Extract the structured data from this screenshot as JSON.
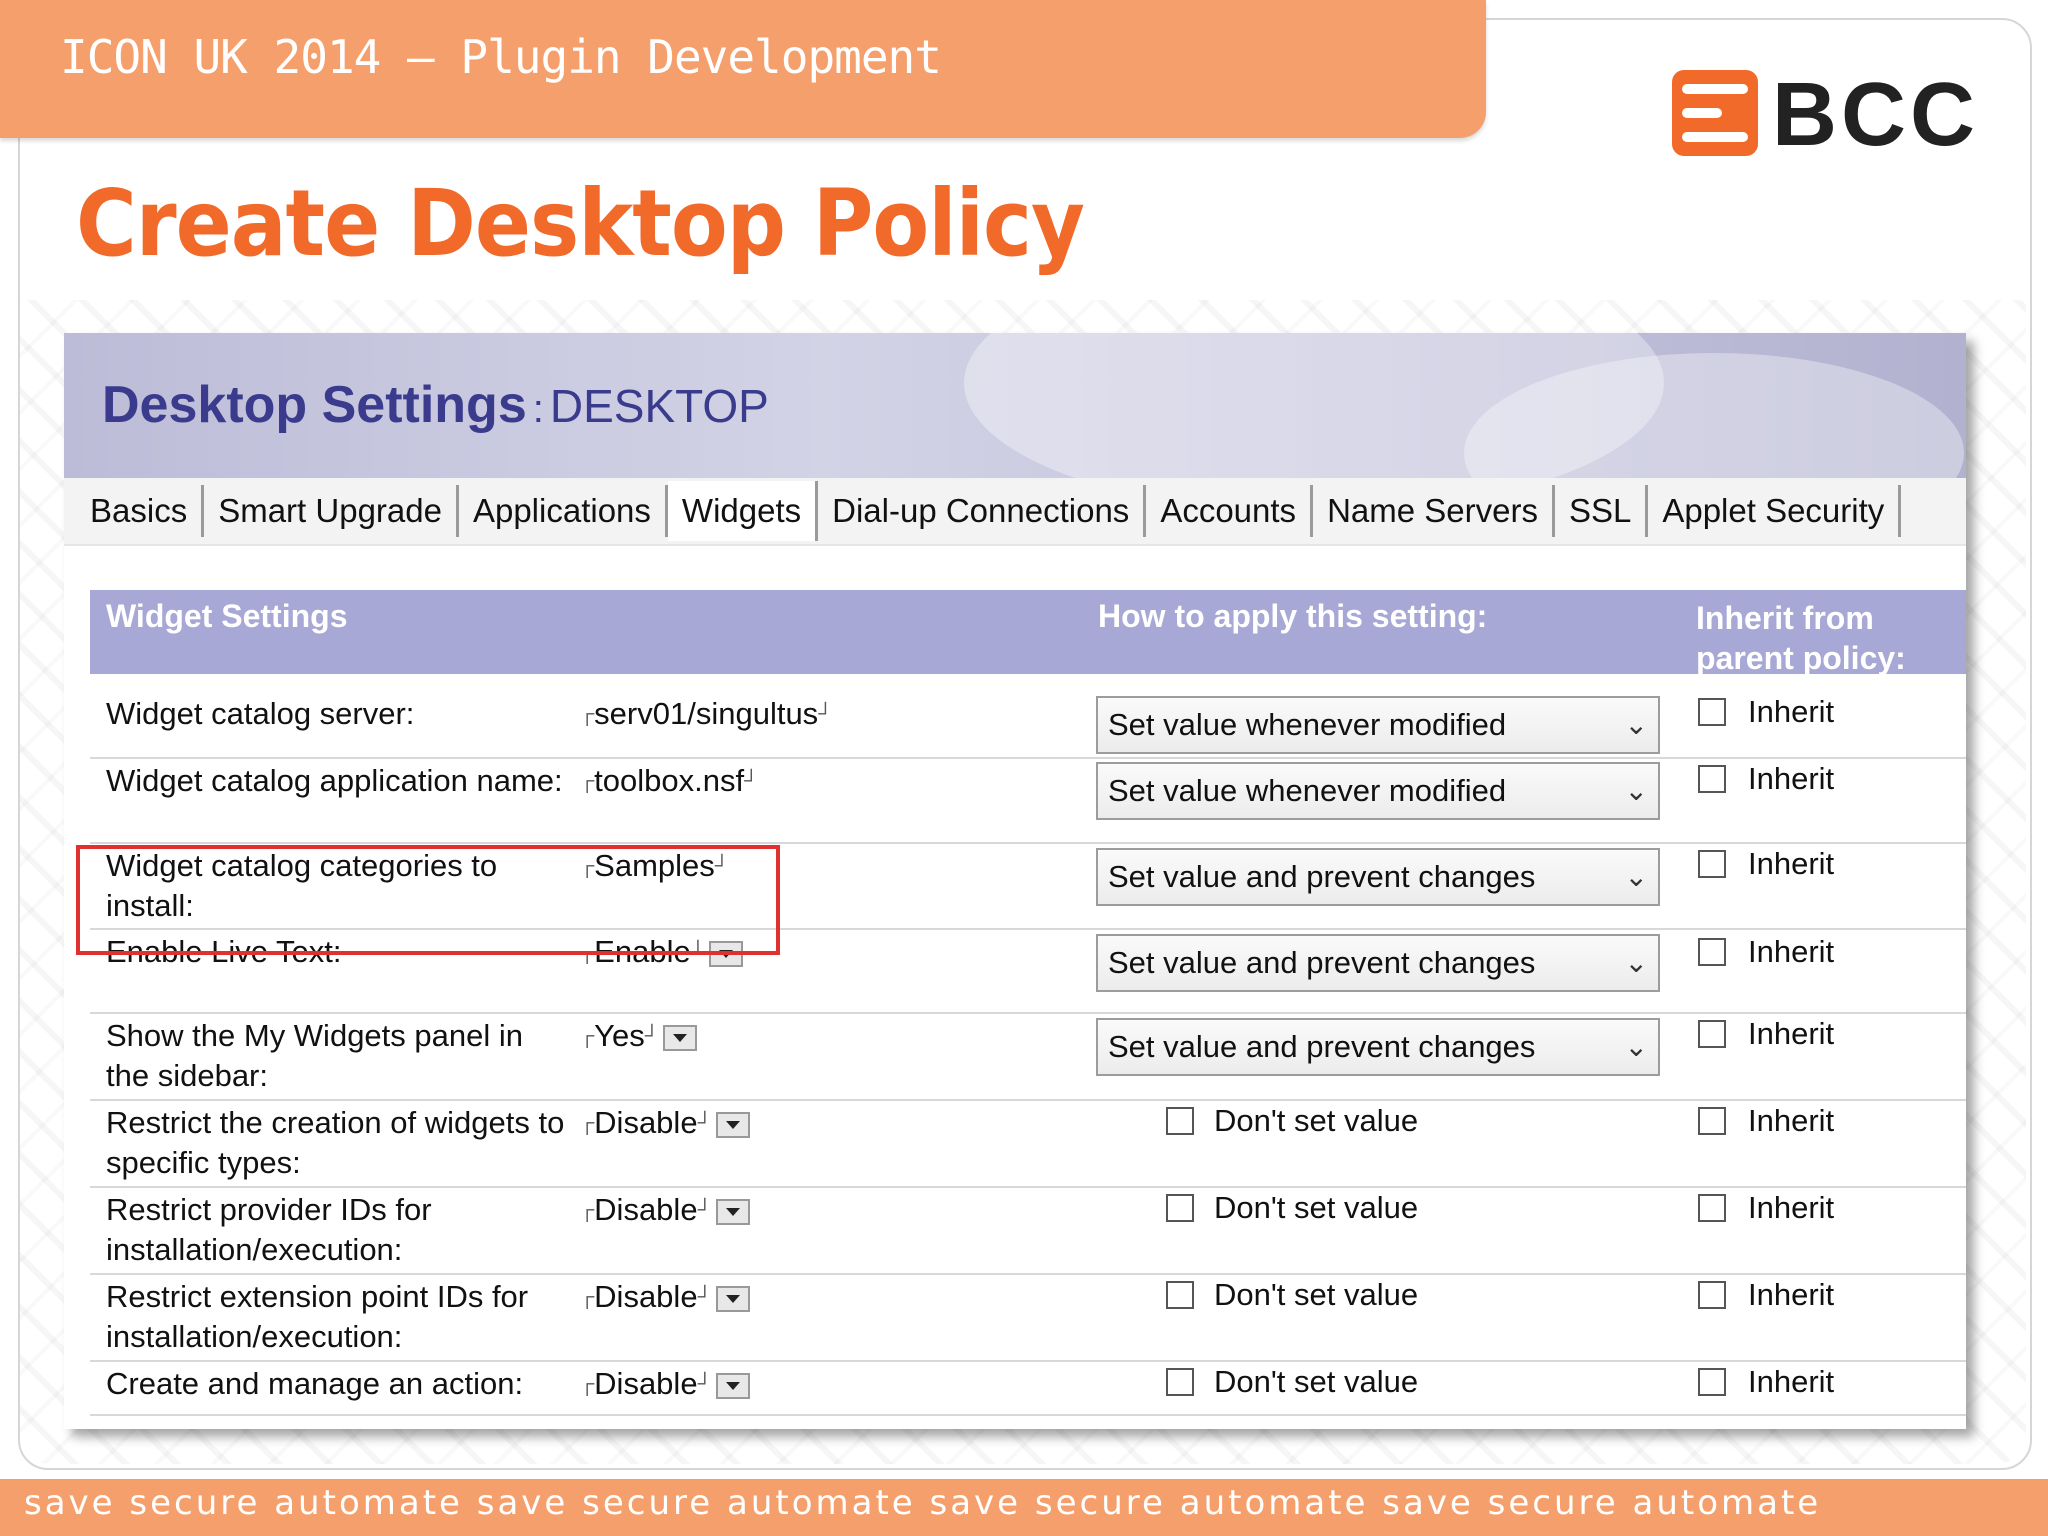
{
  "slide": {
    "header": "ICON UK  2014 – Plugin Development",
    "logo_text": "BCC",
    "title": "Create Desktop Policy",
    "footer": "save secure automate save secure automate save secure automate save secure automate"
  },
  "panel": {
    "title": "Desktop Settings",
    "separator": ":",
    "subtitle": "DESKTOP",
    "tabs": [
      "Basics",
      "Smart Upgrade",
      "Applications",
      "Widgets",
      "Dial-up Connections",
      "Accounts",
      "Name Servers",
      "SSL",
      "Applet Security"
    ],
    "active_tab": "Widgets"
  },
  "settings": {
    "columns": [
      "Widget Settings",
      "How to apply this setting:",
      "Inherit from parent policy:"
    ],
    "rows": [
      {
        "label": "Widget catalog server:",
        "value": "serv01/singultus",
        "apply": "Set value whenever modified",
        "inherit": "Inherit"
      },
      {
        "label": "Widget catalog application name:",
        "value": "toolbox.nsf",
        "apply": "Set value whenever modified",
        "inherit": "Inherit"
      },
      {
        "label": "Widget catalog categories to install:",
        "value": "Samples",
        "apply": "Set value and prevent changes",
        "inherit": "Inherit"
      },
      {
        "label": "Enable Live Text:",
        "value": "Enable",
        "apply": "Set value and prevent changes",
        "inherit": "Inherit"
      },
      {
        "label": "Show the My Widgets panel in the sidebar:",
        "value": "Yes",
        "apply": "Set value and prevent changes",
        "inherit": "Inherit"
      },
      {
        "label": "Restrict the creation of widgets to specific types:",
        "value": "Disable",
        "apply": "Don't set value",
        "inherit": "Inherit"
      },
      {
        "label": "Restrict provider IDs for installation/execution:",
        "value": "Disable",
        "apply": "Don't set value",
        "inherit": "Inherit"
      },
      {
        "label": "Restrict extension point IDs for installation/execution:",
        "value": "Disable",
        "apply": "Don't set value",
        "inherit": "Inherit"
      },
      {
        "label": "Create and manage an action:",
        "value": "Disable",
        "apply": "Don't set value",
        "inherit": "Inherit"
      }
    ]
  },
  "colors": {
    "accent": "#f26a2a",
    "band": "#f5a06c",
    "table_header": "#a8a8d6",
    "panel_title": "#3b3b8e",
    "highlight": "#e03030"
  }
}
